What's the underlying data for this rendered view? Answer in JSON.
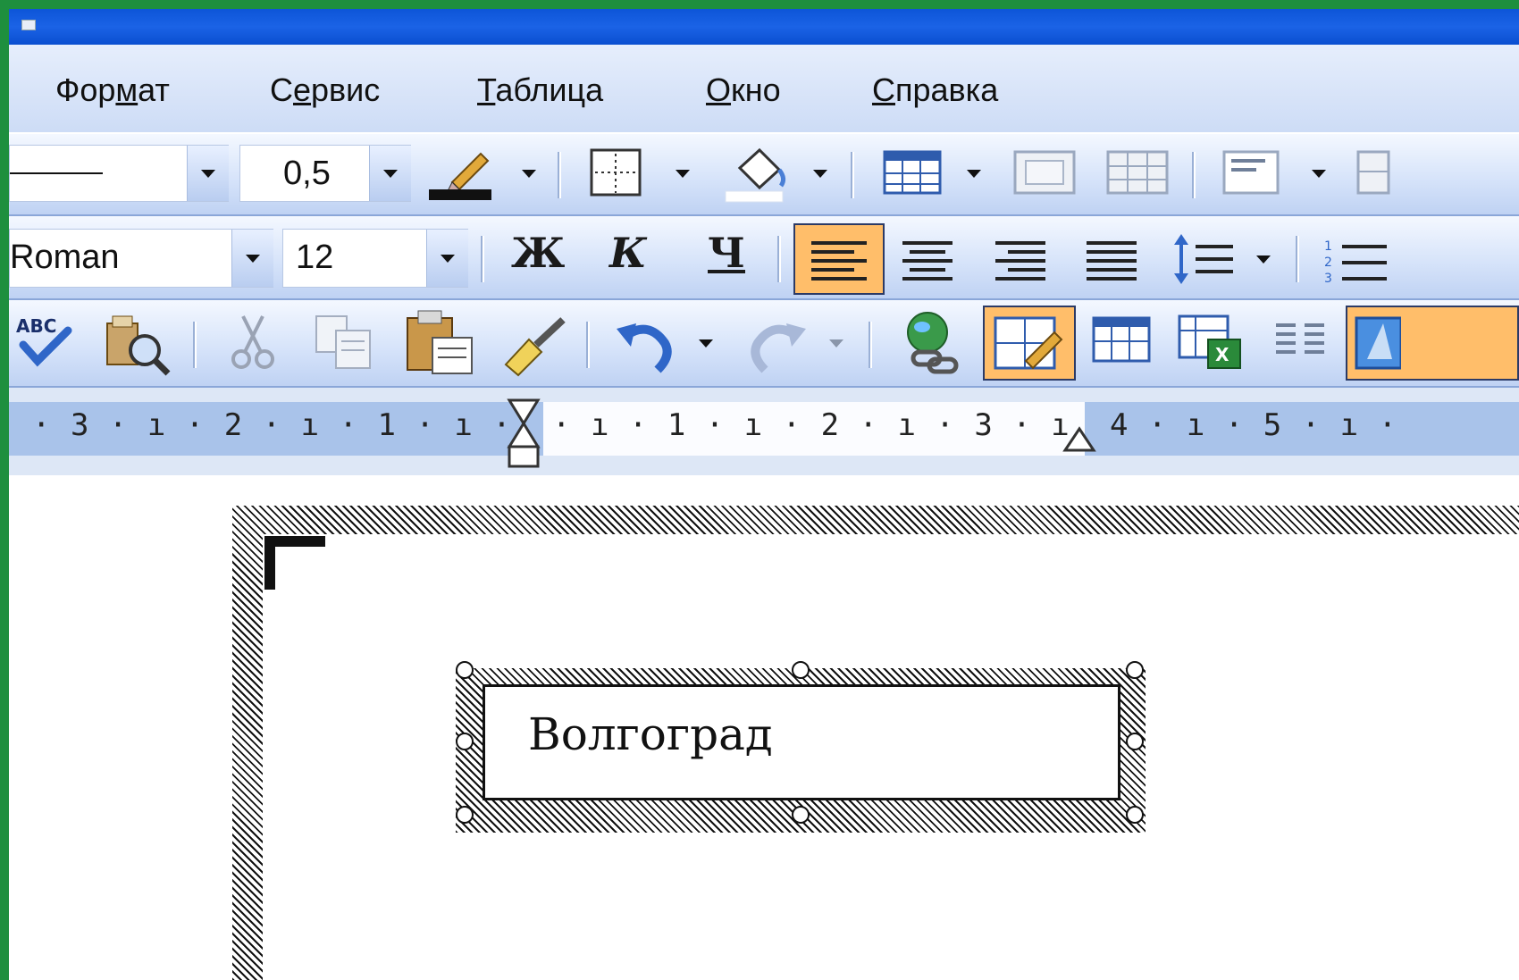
{
  "menu": {
    "format": {
      "pre": "Фор",
      "u": "м",
      "post": "ат"
    },
    "service": {
      "pre": "С",
      "u": "е",
      "post": "рвис"
    },
    "table": {
      "pre": "",
      "u": "Т",
      "post": "аблица"
    },
    "window": {
      "pre": "",
      "u": "О",
      "post": "кно"
    },
    "help": {
      "pre": "",
      "u": "С",
      "post": "правка"
    }
  },
  "tables_toolbar": {
    "line_weight": "0,5"
  },
  "formatting_toolbar": {
    "font_name": "Roman",
    "font_size": "12",
    "bold_label": "Ж",
    "italic_label": "К",
    "underline_label": "Ч"
  },
  "ruler": {
    "left_labels": "· 3 · ı · 2 · ı · 1 · ı ·",
    "right_labels": "· ı · 1 · ı · 2 · ı · 3 · ı",
    "far_labels": "4 · ı · 5 · ı ·"
  },
  "document": {
    "textbox_text": "Волгоград"
  },
  "colors": {
    "titlebar": "#1b63e6",
    "active_button": "#ffbe6a",
    "frame": "#1e8f3e"
  }
}
